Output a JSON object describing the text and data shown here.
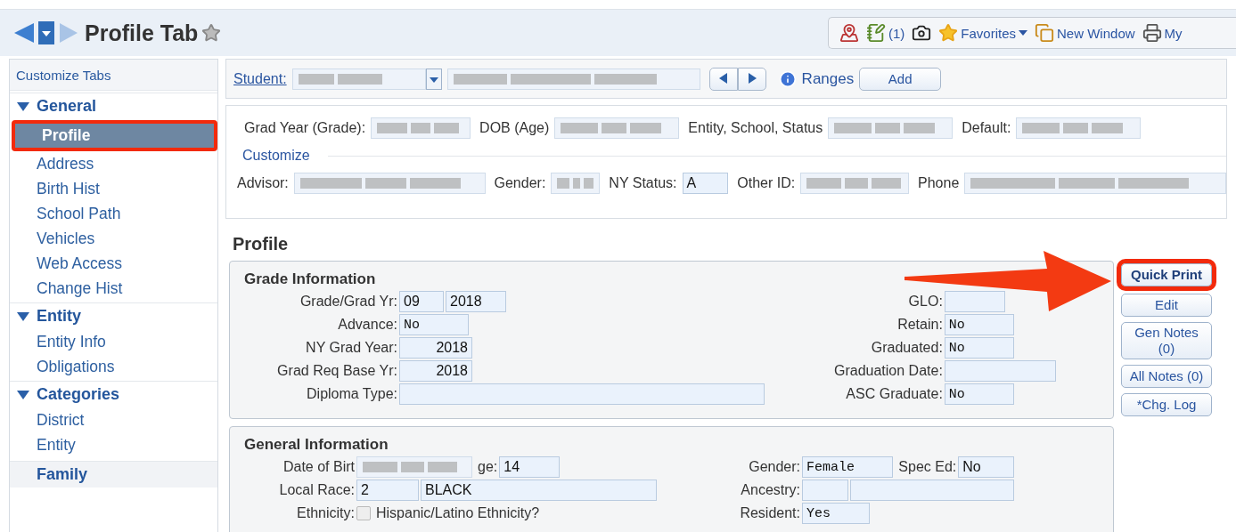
{
  "header": {
    "title": "Profile Tab",
    "toolbar": [
      {
        "kind": "map"
      },
      {
        "kind": "notes",
        "label": "(1)"
      },
      {
        "kind": "camera"
      },
      {
        "kind": "favorites",
        "label": "Favorites"
      },
      {
        "kind": "new-window",
        "label": "New Window"
      },
      {
        "kind": "print",
        "label": "My"
      }
    ]
  },
  "sidebar": {
    "customize": "Customize Tabs",
    "groups": [
      {
        "kind": "section",
        "label": "General",
        "expanded": true,
        "items": [
          {
            "label": "Profile",
            "selected": true,
            "highlighted": true
          },
          {
            "label": "Address",
            "selected": false,
            "highlighted": false
          },
          {
            "label": "Birth Hist",
            "selected": false,
            "highlighted": false
          },
          {
            "label": "School Path",
            "selected": false,
            "highlighted": false
          },
          {
            "label": "Vehicles",
            "selected": false,
            "highlighted": false
          },
          {
            "label": "Web Access",
            "selected": false,
            "highlighted": false
          },
          {
            "label": "Change Hist",
            "selected": false,
            "highlighted": false
          }
        ]
      },
      {
        "kind": "section",
        "label": "Entity",
        "expanded": true,
        "items": [
          {
            "label": "Entity Info",
            "selected": false,
            "highlighted": false
          },
          {
            "label": "Obligations",
            "selected": false,
            "highlighted": false
          }
        ]
      },
      {
        "kind": "section",
        "label": "Categories",
        "expanded": true,
        "items": [
          {
            "label": "District",
            "selected": false,
            "highlighted": false
          },
          {
            "label": "Entity",
            "selected": false,
            "highlighted": false
          }
        ]
      },
      {
        "kind": "link",
        "label": "Family"
      }
    ]
  },
  "student_bar": {
    "label": "Student:",
    "ranges": "Ranges",
    "add": "Add"
  },
  "summary": {
    "line_one": [
      {
        "kind": "label",
        "text": "Grad Year (Grade):"
      },
      {
        "kind": "blurred"
      },
      {
        "kind": "label",
        "text": "DOB (Age)"
      },
      {
        "kind": "blurred"
      },
      {
        "kind": "label",
        "text": "Entity, School, Status"
      },
      {
        "kind": "blurred"
      },
      {
        "kind": "label",
        "text": "Default:"
      },
      {
        "kind": "blurred"
      }
    ],
    "line_two": [
      {
        "kind": "label",
        "text": "Advisor:"
      },
      {
        "kind": "blurred"
      },
      {
        "kind": "label",
        "text": "Gender:"
      },
      {
        "kind": "blurred"
      },
      {
        "kind": "label",
        "text": "NY Status:"
      },
      {
        "kind": "text",
        "value": "A"
      },
      {
        "kind": "label",
        "text": "Other ID:"
      },
      {
        "kind": "blurred"
      },
      {
        "kind": "label",
        "text": "Phone"
      },
      {
        "kind": "blurred"
      }
    ],
    "customize": "Customize"
  },
  "heading": "Profile",
  "grade_information": {
    "title": "Grade Information",
    "rows": [
      {
        "left": {
          "label": "Grade/Grad Yr:",
          "parts": [
            {
              "kind": "text",
              "value": "09"
            },
            {
              "kind": "text",
              "value": "2018"
            }
          ]
        },
        "right": {
          "label": "GLO:",
          "parts": [
            {
              "kind": "text"
            }
          ]
        }
      },
      {
        "left": {
          "label": "Advance:",
          "parts": [
            {
              "kind": "select",
              "value": "No"
            }
          ]
        },
        "right": {
          "label": "Retain:",
          "parts": [
            {
              "kind": "select",
              "value": "No"
            }
          ]
        }
      },
      {
        "left": {
          "label": "NY Grad Year:",
          "parts": [
            {
              "kind": "number",
              "value": "2018"
            }
          ]
        },
        "right": {
          "label": "Graduated:",
          "parts": [
            {
              "kind": "select",
              "value": "No"
            }
          ]
        }
      },
      {
        "left": {
          "label": "Grad Req Base Yr:",
          "parts": [
            {
              "kind": "number",
              "value": "2018"
            }
          ]
        },
        "right": {
          "label": "Graduation Date:",
          "parts": [
            {
              "kind": "text"
            }
          ]
        }
      },
      {
        "left": {
          "label": "Diploma Type:",
          "parts": [
            {
              "kind": "text"
            }
          ]
        },
        "right": {
          "label": "ASC Graduate:",
          "parts": [
            {
              "kind": "select",
              "value": "No"
            }
          ]
        }
      }
    ]
  },
  "side_buttons": [
    {
      "label": "Quick Print",
      "highlighted": true
    },
    {
      "label": "Edit",
      "highlighted": false
    },
    {
      "label": "Gen Notes (0)",
      "highlighted": false
    },
    {
      "label": "All Notes (0)",
      "highlighted": false
    },
    {
      "label": "*Chg. Log",
      "highlighted": false
    }
  ],
  "pointer_arrow": true,
  "general_information": {
    "title": "General Information",
    "rows": [
      {
        "left": {
          "label": "Date of Birt",
          "parts": [
            {
              "kind": "blurred"
            },
            {
              "kind": "label",
              "text": "ge:"
            },
            {
              "kind": "text",
              "value": "14"
            }
          ]
        },
        "right": {
          "label": "Gender:",
          "parts": [
            {
              "kind": "select",
              "value": "Female"
            },
            {
              "kind": "label",
              "text": "Spec Ed:"
            },
            {
              "kind": "text",
              "value": "No"
            }
          ]
        }
      },
      {
        "left": {
          "label": "Local Race:",
          "parts": [
            {
              "kind": "text",
              "value": "2"
            },
            {
              "kind": "text",
              "value": "BLACK"
            }
          ]
        },
        "right": {
          "label": "Ancestry:",
          "parts": [
            {
              "kind": "text"
            },
            {
              "kind": "text"
            }
          ]
        }
      },
      {
        "left": {
          "label": "Ethnicity:",
          "parts": [
            {
              "kind": "checkbox",
              "checked": false,
              "text": "Hispanic/Latino Ethnicity?"
            }
          ]
        },
        "right": {
          "label": "Resident:",
          "parts": [
            {
              "kind": "select",
              "value": "Yes"
            }
          ]
        }
      }
    ]
  }
}
